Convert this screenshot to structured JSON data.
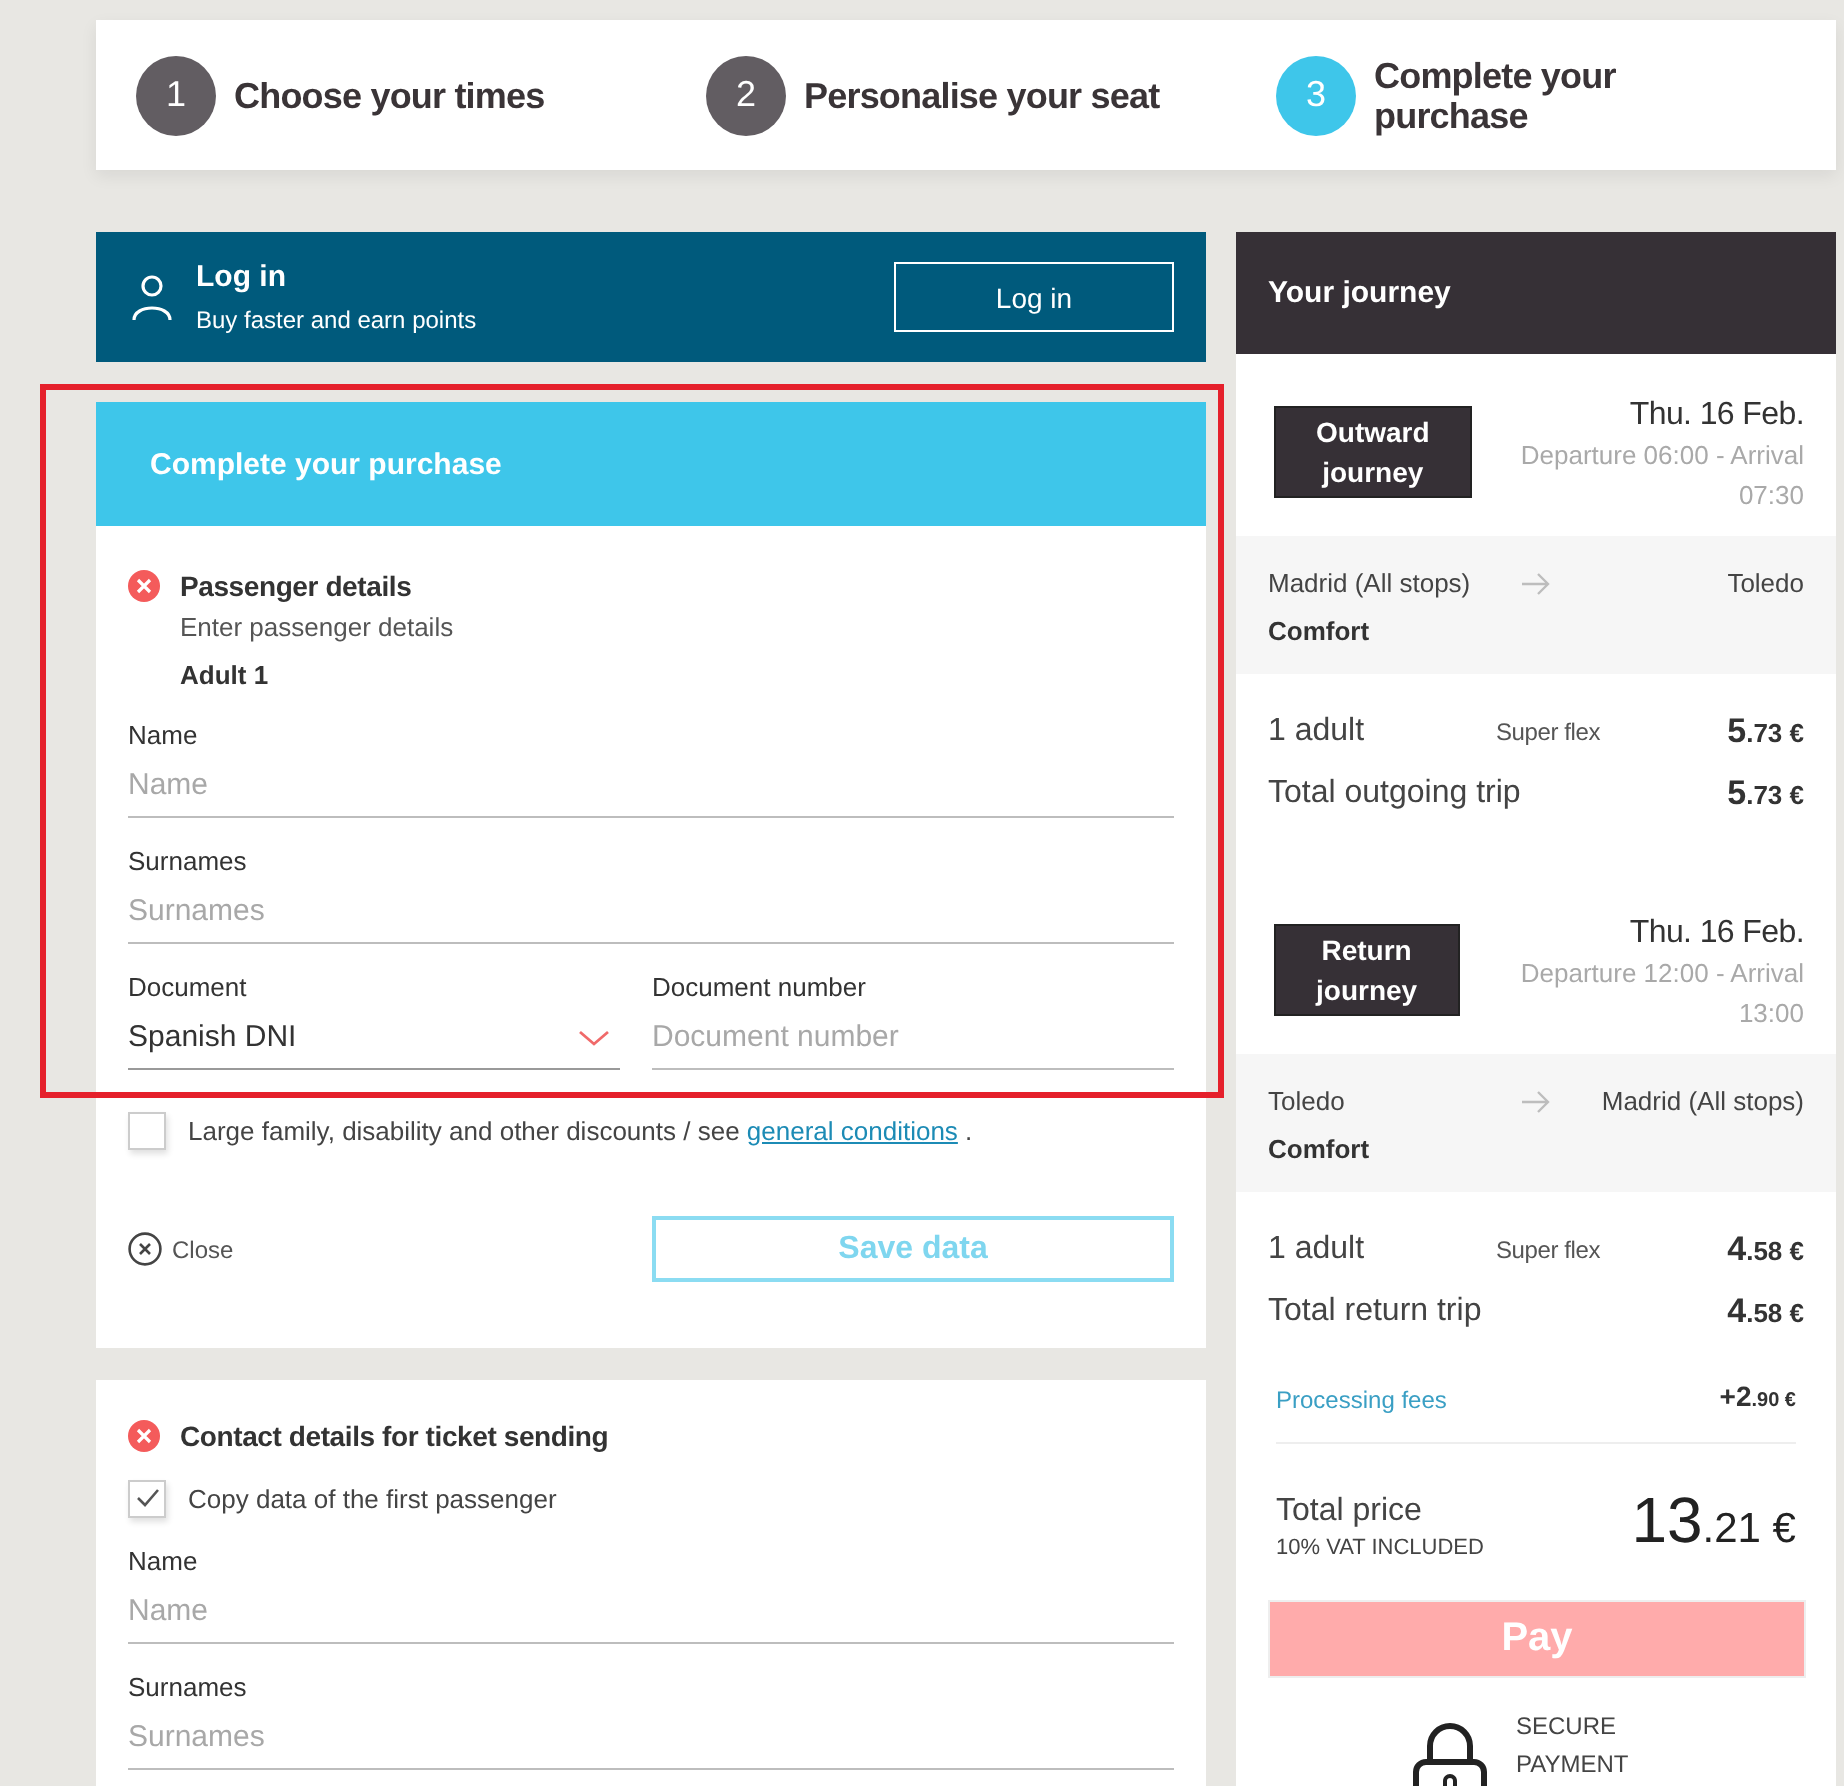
{
  "steps": [
    {
      "number": "1",
      "label": "Choose your times",
      "selected": false
    },
    {
      "number": "2",
      "label": "Personalise your seat",
      "selected": false
    },
    {
      "number": "3",
      "label": "Complete your purchase",
      "selected": true
    }
  ],
  "login": {
    "title": "Log in",
    "subtitle": "Buy faster and earn points",
    "button": "Log in"
  },
  "purchase_form": {
    "title": "Complete your purchase",
    "highlighted": true,
    "section": {
      "title": "Passenger details",
      "valid": false,
      "hint": "Enter passenger details",
      "passenger": "Adult 1"
    },
    "fields": [
      {
        "kind": "input",
        "label": "Name",
        "placeholder": "Name"
      },
      {
        "kind": "input",
        "label": "Surnames",
        "placeholder": "Surnames"
      }
    ],
    "document_row": [
      {
        "kind": "select",
        "label": "Document",
        "value": "Spanish DNI"
      },
      {
        "kind": "input",
        "label": "Document number",
        "placeholder": "Document number"
      }
    ],
    "discount": {
      "checked": false,
      "text": "Large family, disability and other discounts / see",
      "link": "general conditions",
      "after": "."
    },
    "close": "Close",
    "save_button": {
      "label": "Save data",
      "disabled": true
    }
  },
  "contact_form": {
    "title": "Contact details for ticket sending",
    "valid": false,
    "copy_option": {
      "label": "Copy data of the first passenger",
      "checked": true
    },
    "fields": [
      {
        "kind": "input",
        "label": "Name",
        "placeholder": "Name"
      },
      {
        "kind": "input",
        "label": "Surnames",
        "placeholder": "Surnames"
      }
    ]
  },
  "journey": {
    "title": "Your journey",
    "legs": [
      {
        "badge": "Outward journey",
        "date": "Thu. 16 Feb.",
        "times": "Departure 06:00 - Arrival 07:30",
        "from": "Madrid (All stops)",
        "to": "Toledo",
        "fare_class": "Comfort",
        "passengers": "1 adult",
        "fare": "Super flex",
        "price": {
          "units": "5",
          "cents": ".73 €"
        },
        "total_label": "Total outgoing trip",
        "total": {
          "units": "5",
          "cents": ".73 €"
        }
      },
      {
        "badge": "Return journey",
        "date": "Thu. 16 Feb.",
        "times": "Departure 12:00 - Arrival 13:00",
        "from": "Toledo",
        "to": "Madrid (All stops)",
        "fare_class": "Comfort",
        "passengers": "1 adult",
        "fare": "Super flex",
        "price": {
          "units": "4",
          "cents": ".58 €"
        },
        "total_label": "Total return trip",
        "total": {
          "units": "4",
          "cents": ".58 €"
        }
      }
    ],
    "fees": {
      "label": "Processing fees",
      "amount": {
        "units": "+2",
        "cents": ".90 €"
      }
    },
    "total": {
      "label": "Total price",
      "note": "10% VAT INCLUDED",
      "amount": {
        "units": "13",
        "cents": ".21 €"
      }
    },
    "pay_button": {
      "label": "Pay",
      "disabled": true
    },
    "secure": "SECURE PAYMENT"
  }
}
